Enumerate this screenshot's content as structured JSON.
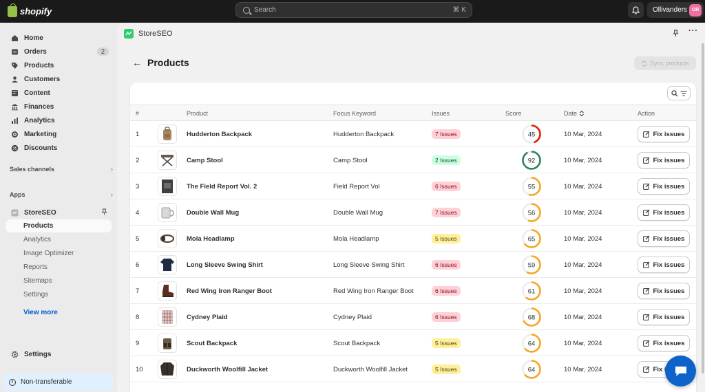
{
  "topbar": {
    "logo_text": "shopify",
    "search_placeholder": "Search",
    "search_shortcut": "⌘ K",
    "store_name": "Ollivanders",
    "store_initials": "OR",
    "icons": [
      "shopify-bag-icon",
      "search-icon",
      "bell-icon"
    ]
  },
  "sidebar": {
    "nav": [
      {
        "label": "Home",
        "icon": "home-icon"
      },
      {
        "label": "Orders",
        "icon": "orders-icon",
        "badge": "2"
      },
      {
        "label": "Products",
        "icon": "tag-icon"
      },
      {
        "label": "Customers",
        "icon": "person-icon"
      },
      {
        "label": "Content",
        "icon": "content-icon"
      },
      {
        "label": "Finances",
        "icon": "bank-icon"
      },
      {
        "label": "Analytics",
        "icon": "chart-icon"
      },
      {
        "label": "Marketing",
        "icon": "target-icon"
      },
      {
        "label": "Discounts",
        "icon": "discount-icon"
      }
    ],
    "sales_channels_label": "Sales channels",
    "apps_label": "Apps",
    "app_name": "StoreSEO",
    "app_subitems": [
      "Products",
      "Analytics",
      "Image Optimizer",
      "Reports",
      "Sitemaps",
      "Settings"
    ],
    "view_more": "View more",
    "settings_label": "Settings",
    "nontransferable": "Non-transferable"
  },
  "app": {
    "name": "StoreSEO",
    "page_title": "Products",
    "sync_button": "Sync products"
  },
  "table": {
    "headers": {
      "num": "#",
      "product": "Product",
      "keyword": "Focus Keyword",
      "issues": "Issues",
      "score": "Score",
      "date": "Date",
      "action": "Action"
    },
    "fix_label": "Fix issues",
    "rows": [
      {
        "num": "1",
        "name": "Hudderton Backpack",
        "keyword": "Hudderton Backpack",
        "issues": "7 Issues",
        "level": "red",
        "score": 45,
        "date": "10 Mar, 2024",
        "thumb": "backpack"
      },
      {
        "num": "2",
        "name": "Camp Stool",
        "keyword": "Camp Stool",
        "issues": "2 Issues",
        "level": "green",
        "score": 92,
        "date": "10 Mar, 2024",
        "thumb": "stool"
      },
      {
        "num": "3",
        "name": "The Field Report Vol. 2",
        "keyword": "Field Report Vol",
        "issues": "6 Issues",
        "level": "red",
        "score": 55,
        "date": "10 Mar, 2024",
        "thumb": "book"
      },
      {
        "num": "4",
        "name": "Double Wall Mug",
        "keyword": "Double Wall Mug",
        "issues": "7 Issues",
        "level": "red",
        "score": 56,
        "date": "10 Mar, 2024",
        "thumb": "mug"
      },
      {
        "num": "5",
        "name": "Mola Headlamp",
        "keyword": "Mola Headlamp",
        "issues": "5 Issues",
        "level": "yellow",
        "score": 65,
        "date": "10 Mar, 2024",
        "thumb": "headlamp"
      },
      {
        "num": "6",
        "name": "Long Sleeve Swing Shirt",
        "keyword": "Long Sleeve Swing Shirt",
        "issues": "6 Issues",
        "level": "red",
        "score": 59,
        "date": "10 Mar, 2024",
        "thumb": "shirt"
      },
      {
        "num": "7",
        "name": "Red Wing Iron Ranger Boot",
        "keyword": "Red Wing Iron Ranger Boot",
        "issues": "6 Issues",
        "level": "red",
        "score": 61,
        "date": "10 Mar, 2024",
        "thumb": "boot"
      },
      {
        "num": "8",
        "name": "Cydney Plaid",
        "keyword": "Cydney Plaid",
        "issues": "6 Issues",
        "level": "red",
        "score": 68,
        "date": "10 Mar, 2024",
        "thumb": "plaid"
      },
      {
        "num": "9",
        "name": "Scout Backpack",
        "keyword": "Scout Backpack",
        "issues": "5 Issues",
        "level": "yellow",
        "score": 64,
        "date": "10 Mar, 2024",
        "thumb": "backpack2"
      },
      {
        "num": "10",
        "name": "Duckworth Woolfill Jacket",
        "keyword": "Duckworth Woolfill Jacket",
        "issues": "5 Issues",
        "level": "yellow",
        "score": 64,
        "date": "10 Mar, 2024",
        "thumb": "jacket"
      }
    ]
  },
  "colors": {
    "issue_red_bg": "#fed1d7",
    "issue_red_fg": "#8e0b21",
    "issue_green_bg": "#cdfee1",
    "issue_green_fg": "#0c5132",
    "issue_yellow_bg": "#ffef9d",
    "issue_yellow_fg": "#4f4700",
    "score_red": "#e51c00",
    "score_orange": "#f5a623",
    "score_green": "#29845a",
    "chat_blue": "#0d63c9"
  }
}
